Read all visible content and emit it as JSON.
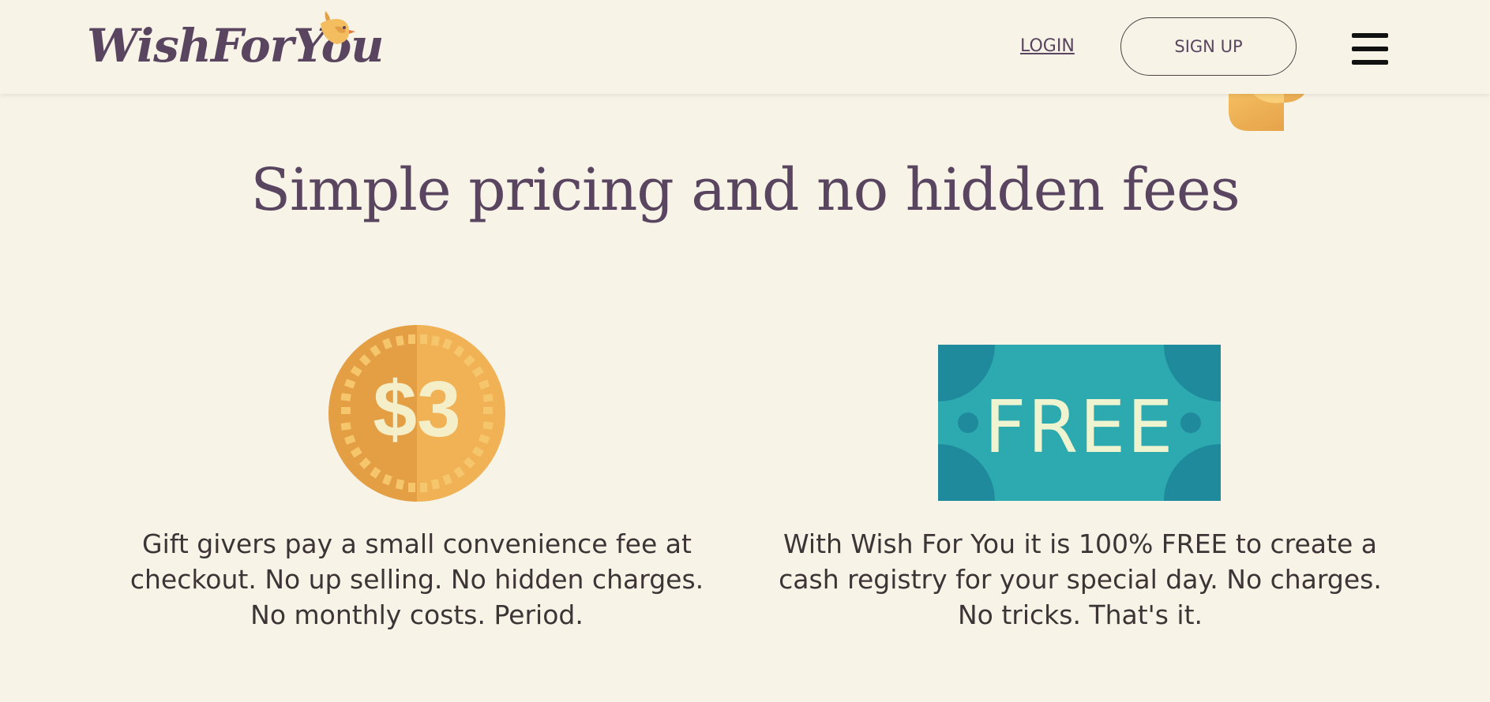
{
  "brand": {
    "name": "WishForYou",
    "icon": "bird-icon"
  },
  "nav": {
    "login_label": "LOGIN",
    "signup_label": "SIGN UP",
    "menu_icon": "hamburger-menu-icon"
  },
  "colors": {
    "background": "#f7f3e7",
    "brand_purple": "#5a4560",
    "coin_orange": "#e49f45",
    "coin_gold": "#f4bd60",
    "badge_teal": "#2daab0",
    "badge_dark_teal": "#1e8a9c",
    "badge_text": "#eef4cf"
  },
  "main": {
    "headline": "Simple pricing and no hidden fees",
    "features": [
      {
        "icon": "coin-icon",
        "graphic_text": "$3",
        "description": "Gift givers pay a small convenience fee at checkout. No up selling. No hidden charges. No monthly costs. Period."
      },
      {
        "icon": "free-ticket-icon",
        "graphic_text": "FREE",
        "description": "With Wish For You it is 100% FREE to create a cash registry for your special day. No charges. No tricks. That's it."
      }
    ]
  }
}
